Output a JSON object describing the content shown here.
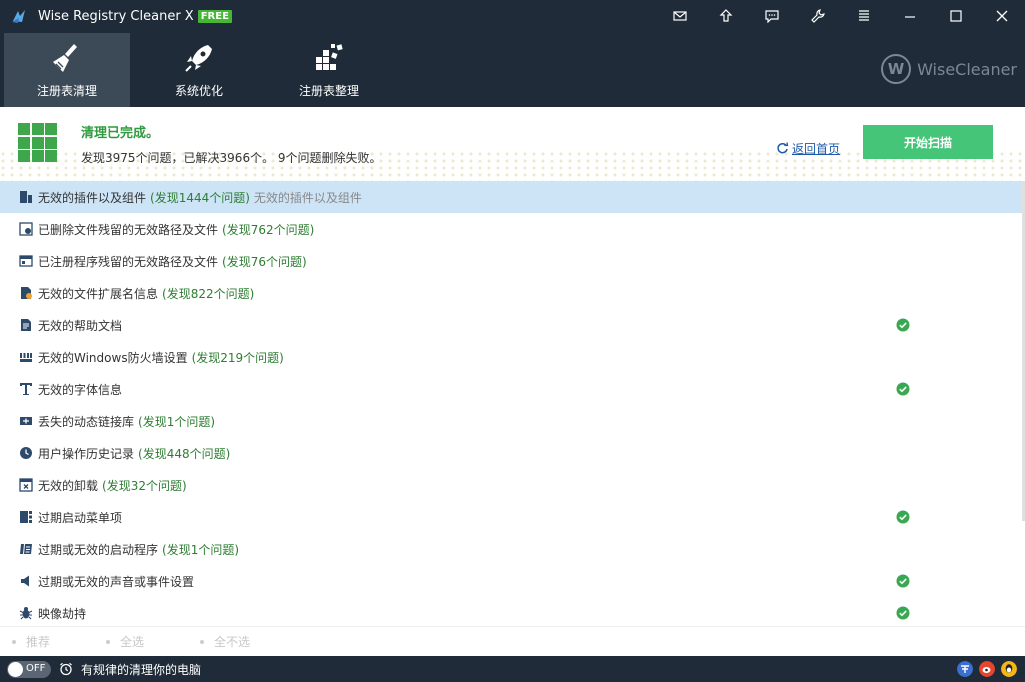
{
  "window": {
    "title": "Wise Registry Cleaner X",
    "badge": "FREE"
  },
  "toolbar": {
    "tabs": [
      {
        "label": "注册表清理",
        "icon": "broom-icon",
        "active": true
      },
      {
        "label": "系统优化",
        "icon": "rocket-icon",
        "active": false
      },
      {
        "label": "注册表整理",
        "icon": "defrag-icon",
        "active": false
      }
    ],
    "brand": "WiseCleaner"
  },
  "status": {
    "title": "清理已完成。",
    "summary": "发现3975个问题，已解决3966个。 9个问题删除失败。",
    "back_link": "返回首页",
    "scan_button": "开始扫描"
  },
  "items": [
    {
      "name": "无效的插件以及组件",
      "count": "(发现1444个问题)",
      "hint": "无效的插件以及组件",
      "checked": false,
      "selected": true
    },
    {
      "name": "已删除文件残留的无效路径及文件",
      "count": "(发现762个问题)",
      "checked": false
    },
    {
      "name": "已注册程序残留的无效路径及文件",
      "count": "(发现76个问题)",
      "checked": false
    },
    {
      "name": "无效的文件扩展名信息",
      "count": "(发现822个问题)",
      "checked": false
    },
    {
      "name": "无效的帮助文档",
      "count": "",
      "checked": true
    },
    {
      "name": "无效的Windows防火墙设置",
      "count": "(发现219个问题)",
      "checked": false
    },
    {
      "name": "无效的字体信息",
      "count": "",
      "checked": true
    },
    {
      "name": "丢失的动态链接库",
      "count": "(发现1个问题)",
      "checked": false
    },
    {
      "name": "用户操作历史记录",
      "count": "(发现448个问题)",
      "checked": false
    },
    {
      "name": "无效的卸载",
      "count": "(发现32个问题)",
      "checked": false
    },
    {
      "name": "过期启动菜单项",
      "count": "",
      "checked": true
    },
    {
      "name": "过期或无效的启动程序",
      "count": "(发现1个问题)",
      "checked": false
    },
    {
      "name": "过期或无效的声音或事件设置",
      "count": "",
      "checked": true
    },
    {
      "name": "映像劫持",
      "count": "",
      "checked": true
    }
  ],
  "selector": {
    "recommend": "推荐",
    "select_all": "全选",
    "select_none": "全不选"
  },
  "footer": {
    "toggle_label": "OFF",
    "schedule_text": "有规律的清理你的电脑"
  },
  "colors": {
    "dark": "#1f2b38",
    "active_tab": "#3c4957",
    "green": "#3fa74b",
    "scan_button": "#45c578",
    "selected_row": "#cde4f7"
  }
}
